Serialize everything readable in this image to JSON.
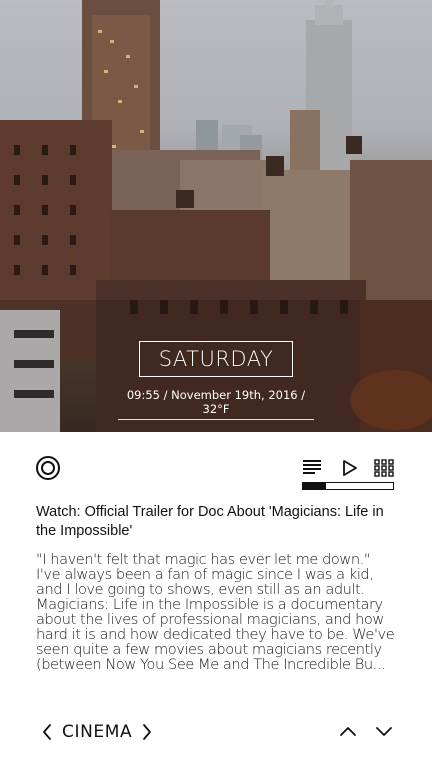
{
  "hero": {
    "day": "SATURDAY",
    "datetime": "09:55 / November 19th, 2016 / 32°F"
  },
  "controls": {
    "record_icon": "circle-icon",
    "list_icon": "lines-icon",
    "play_icon": "play-icon",
    "grid_icon": "grid-icon",
    "progress_fraction": 0.26
  },
  "article": {
    "title": "Watch: Official Trailer for Doc About 'Magicians: Life in the Impossible'",
    "body": "\"I haven't felt that magic has ever let me down.\" I've always been a fan of magic since I was a kid, and I love going to shows, even still as an adult. Magicians: Life in the Impossible is a documentary about the lives of professional magicians, and how hard it is and how dedicated they have to be. We've seen quite a few movies about magicians recently (between Now You See Me and The Incredible Bu..."
  },
  "nav": {
    "section": "CINEMA",
    "prev_icon": "chevron-left-icon",
    "next_icon": "chevron-right-icon",
    "up_icon": "chevron-up-icon",
    "down_icon": "chevron-down-icon"
  },
  "colors": {
    "text": "#111111",
    "background": "#ffffff",
    "overlay_text": "#ffffff"
  }
}
